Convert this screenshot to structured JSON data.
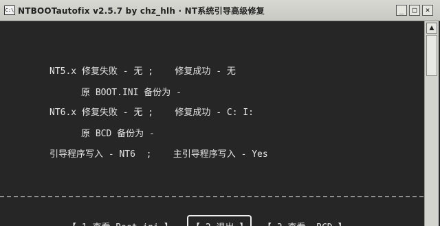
{
  "window": {
    "title": "NTBOOTautofix v2.5.7 by chz_hlh · NT系统引导高级修复",
    "app_icon": "C:\\",
    "controls": {
      "minimize": "_",
      "maximize": "□",
      "close": "×"
    }
  },
  "report": {
    "nt5_line": "NT5.x 修复失败 - 无 ;    修复成功 - 无",
    "nt5_backup": "原 BOOT.INI 备份为 -",
    "nt6_line": "NT6.x 修复失败 - 无 ;    修复成功 - C: I:",
    "nt6_backup": "原 BCD 备份为 -",
    "loader_line": "引导程序写入 - NT6  ;    主引导程序写入 - Yes"
  },
  "menu": {
    "items": [
      {
        "label": "【 1.查看 Boot.ini 】"
      },
      {
        "label": "【 2.退出 】",
        "selected": true
      },
      {
        "label": "【 3.查看  BCD 】"
      }
    ]
  },
  "icons": {
    "scroll_up": "scroll-up-arrow-icon"
  }
}
